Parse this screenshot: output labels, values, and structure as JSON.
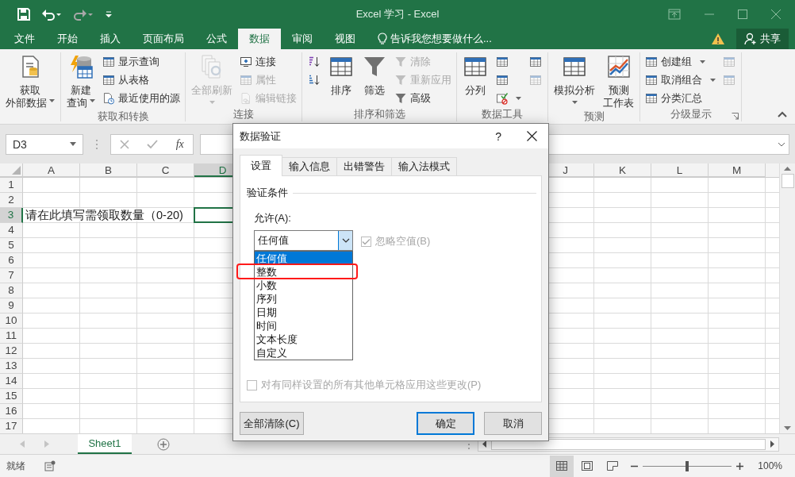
{
  "title_bar": {
    "title": "Excel 学习 - Excel",
    "quick_access": [
      {
        "kind": "save",
        "disabled": false
      },
      {
        "kind": "undo",
        "disabled": false
      },
      {
        "kind": "redo",
        "disabled": true
      },
      {
        "kind": "customize",
        "disabled": false
      }
    ]
  },
  "ribbon_tabs": [
    {
      "label": "文件",
      "selected": false
    },
    {
      "label": "开始",
      "selected": false
    },
    {
      "label": "插入",
      "selected": false
    },
    {
      "label": "页面布局",
      "selected": false
    },
    {
      "label": "公式",
      "selected": false
    },
    {
      "label": "数据",
      "selected": true
    },
    {
      "label": "审阅",
      "selected": false
    },
    {
      "label": "视图",
      "selected": false
    }
  ],
  "tell_me": {
    "placeholder": "告诉我您想要做什么..."
  },
  "share_button": "共享",
  "ribbon_groups": [
    {
      "buttons": [
        {
          "kind": "large",
          "lines": [
            "获取",
            "外部数据"
          ],
          "dropdown": true,
          "disabled": false
        }
      ]
    },
    {
      "label": "获取和转换",
      "buttons": [
        {
          "kind": "large",
          "lines": [
            "新建",
            "查询"
          ],
          "dropdown": true,
          "disabled": false
        },
        {
          "kind": "small",
          "label": "显示查询",
          "dropdown": false,
          "disabled": false
        },
        {
          "kind": "small",
          "label": "从表格",
          "dropdown": false,
          "disabled": false
        },
        {
          "kind": "small",
          "label": "最近使用的源",
          "dropdown": false,
          "disabled": false
        }
      ]
    },
    {
      "label": "连接",
      "buttons": [
        {
          "kind": "large",
          "lines": [
            "全部刷新"
          ],
          "dropdown": true,
          "disabled": true
        },
        {
          "kind": "small",
          "label": "连接",
          "dropdown": false,
          "disabled": false
        },
        {
          "kind": "small",
          "label": "属性",
          "dropdown": false,
          "disabled": true
        },
        {
          "kind": "small",
          "label": "编辑链接",
          "dropdown": false,
          "disabled": true
        }
      ]
    },
    {
      "label": "排序和筛选",
      "buttons": [
        {
          "kind": "icon",
          "dropdown": false,
          "disabled": false
        },
        {
          "kind": "icon",
          "dropdown": false,
          "disabled": false
        },
        {
          "kind": "large",
          "lines": [
            "排序"
          ],
          "dropdown": false,
          "disabled": false
        },
        {
          "kind": "large",
          "lines": [
            "筛选"
          ],
          "dropdown": false,
          "disabled": false
        },
        {
          "kind": "small",
          "label": "清除",
          "dropdown": false,
          "disabled": true
        },
        {
          "kind": "small",
          "label": "重新应用",
          "dropdown": false,
          "disabled": true
        },
        {
          "kind": "small",
          "label": "高级",
          "dropdown": false,
          "disabled": false
        }
      ]
    },
    {
      "label": "数据工具",
      "buttons": [
        {
          "kind": "large",
          "lines": [
            "分列"
          ],
          "dropdown": false,
          "disabled": false
        },
        {
          "kind": "icon",
          "dropdown": false,
          "disabled": false
        },
        {
          "kind": "icon",
          "dropdown": false,
          "disabled": false
        },
        {
          "kind": "icon",
          "dropdown": true,
          "disabled": false
        },
        {
          "kind": "icon",
          "dropdown": false,
          "disabled": false
        },
        {
          "kind": "icon",
          "dropdown": false,
          "disabled": true
        }
      ]
    },
    {
      "label": "预测",
      "buttons": [
        {
          "kind": "large",
          "lines": [
            "模拟分析"
          ],
          "dropdown": true,
          "disabled": false
        },
        {
          "kind": "large",
          "lines": [
            "预测",
            "工作表"
          ],
          "dropdown": false,
          "disabled": false
        }
      ]
    },
    {
      "label": "分级显示",
      "launcher": true,
      "buttons": [
        {
          "kind": "small",
          "label": "创建组",
          "dropdown": true,
          "disabled": false
        },
        {
          "kind": "small",
          "label": "取消组合",
          "dropdown": true,
          "disabled": false
        },
        {
          "kind": "small",
          "label": "分类汇总",
          "dropdown": false,
          "disabled": false
        },
        {
          "kind": "icon",
          "dropdown": false,
          "disabled": true
        },
        {
          "kind": "icon",
          "dropdown": false,
          "disabled": true
        }
      ]
    }
  ],
  "name_box": "D3",
  "function_button": "fx",
  "grid": {
    "columns": [
      {
        "label": "A",
        "selected": false
      },
      {
        "label": "B",
        "selected": false
      },
      {
        "label": "C",
        "selected": false
      },
      {
        "label": "D",
        "selected": true
      },
      {
        "label": "J",
        "selected": false
      },
      {
        "label": "K",
        "selected": false
      },
      {
        "label": "L",
        "selected": false
      },
      {
        "label": "M",
        "selected": false
      }
    ],
    "rows": [
      {
        "number": "1",
        "selected": false
      },
      {
        "number": "2",
        "selected": false
      },
      {
        "number": "3",
        "selected": true,
        "text": "请在此填写需领取数量（0-20)"
      },
      {
        "number": "4",
        "selected": false
      },
      {
        "number": "5",
        "selected": false
      },
      {
        "number": "6",
        "selected": false
      },
      {
        "number": "7",
        "selected": false
      },
      {
        "number": "8",
        "selected": false
      },
      {
        "number": "9",
        "selected": false
      },
      {
        "number": "10",
        "selected": false
      },
      {
        "number": "11",
        "selected": false
      },
      {
        "number": "12",
        "selected": false
      },
      {
        "number": "13",
        "selected": false
      },
      {
        "number": "14",
        "selected": false
      },
      {
        "number": "15",
        "selected": false
      },
      {
        "number": "16",
        "selected": false
      },
      {
        "number": "17",
        "selected": false
      }
    ]
  },
  "sheet_tabs": [
    {
      "label": "Sheet1",
      "selected": true
    }
  ],
  "status_bar": {
    "status": "就绪",
    "views": [
      {
        "kind": "normal",
        "selected": true
      },
      {
        "kind": "page_layout",
        "selected": false
      },
      {
        "kind": "page_break",
        "selected": false
      }
    ],
    "zoom": {
      "level": 0.5,
      "reading": "100%"
    }
  },
  "dialog": {
    "title": "数据验证",
    "help_button": "?",
    "tabs": [
      {
        "label": "设置",
        "selected": true
      },
      {
        "label": "输入信息",
        "selected": false
      },
      {
        "label": "出错警告",
        "selected": false
      },
      {
        "label": "输入法模式",
        "selected": false
      }
    ],
    "section": "验证条件",
    "allow_label": "允许(A):",
    "allow_value": "任何值",
    "allow_options": [
      {
        "label": "任何值",
        "selected": true
      },
      {
        "label": "整数",
        "selected": false
      },
      {
        "label": "小数",
        "selected": false
      },
      {
        "label": "序列",
        "selected": false
      },
      {
        "label": "日期",
        "selected": false
      },
      {
        "label": "时间",
        "selected": false
      },
      {
        "label": "文本长度",
        "selected": false
      },
      {
        "label": "自定义",
        "selected": false
      }
    ],
    "ignore_blank": {
      "label": "忽略空值(B)",
      "checked": true,
      "disabled": true
    },
    "apply_all": {
      "label": "对有同样设置的所有其他单元格应用这些更改(P)",
      "checked": false,
      "disabled": true
    },
    "buttons": [
      {
        "label": "全部清除(C)",
        "default": false
      },
      {
        "label": "确定",
        "default": true
      },
      {
        "label": "取消",
        "default": false
      }
    ]
  }
}
